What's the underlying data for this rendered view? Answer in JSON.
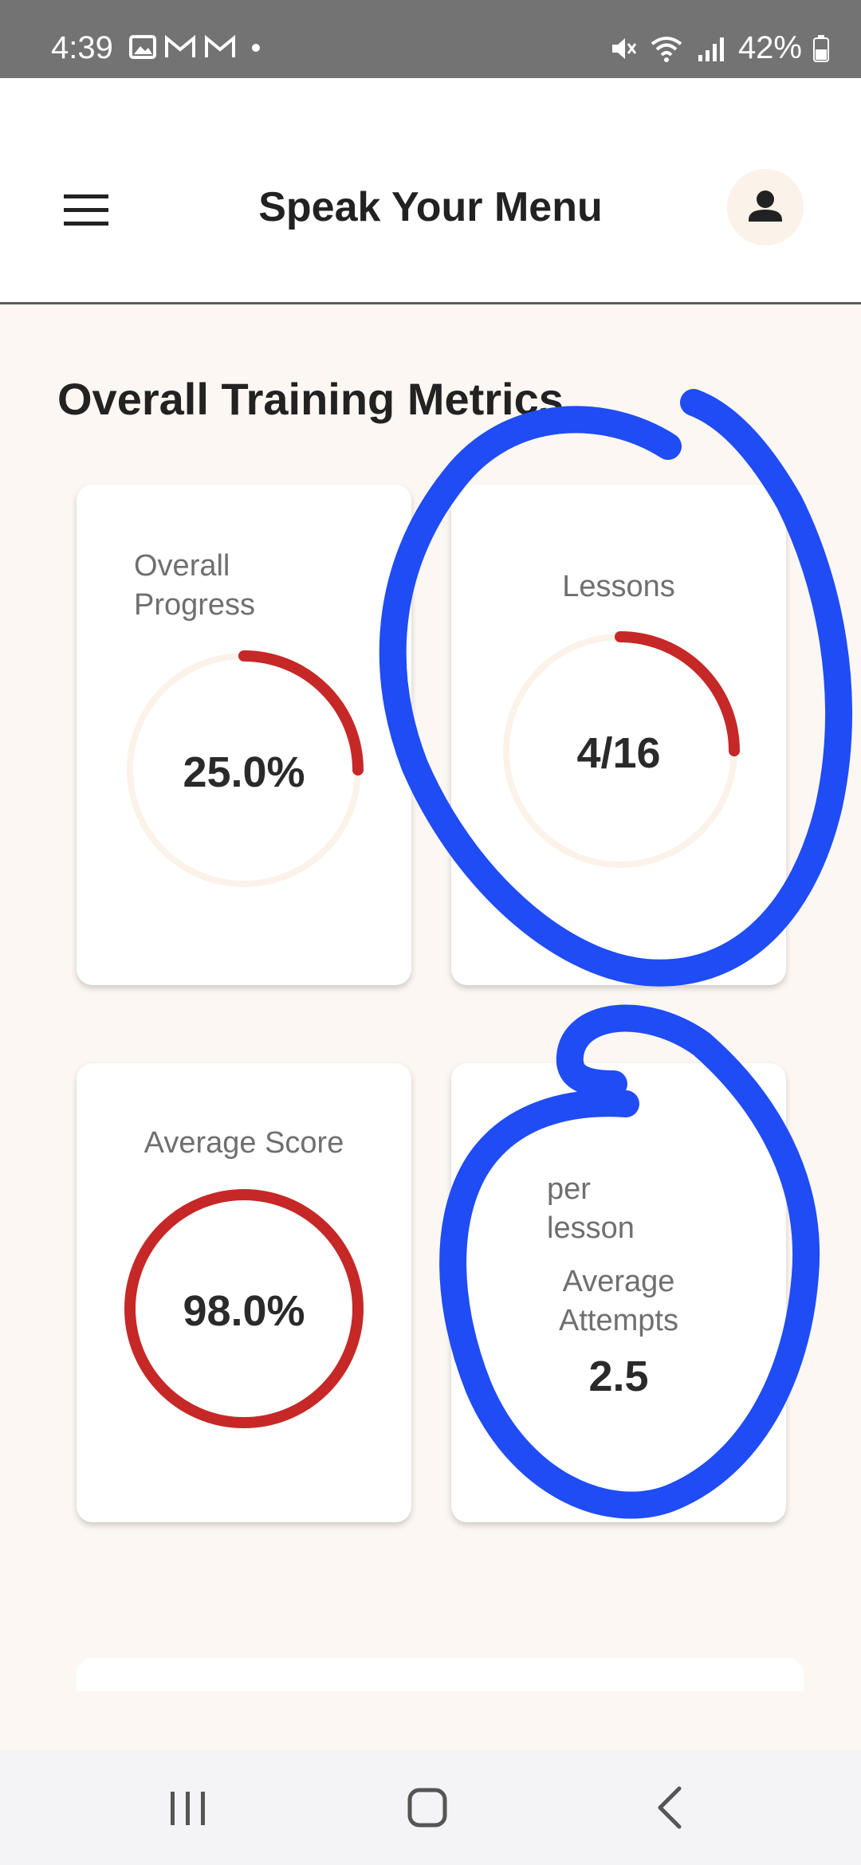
{
  "status_bar": {
    "time": "4:39",
    "battery": "42%",
    "icons": [
      "image-icon",
      "gmail-icon",
      "gmail-icon",
      "dot-icon",
      "mute-icon",
      "wifi-icon",
      "signal-icon",
      "battery-icon"
    ]
  },
  "app_bar": {
    "title": "Speak Your Menu",
    "menu_icon": "hamburger-menu-icon",
    "profile_icon": "person-icon"
  },
  "section": {
    "title": "Overall Training Metrics"
  },
  "metrics": {
    "overall_progress": {
      "label_line1": "Overall",
      "label_line2": "Progress",
      "value": "25.0%",
      "fraction": 0.25
    },
    "lessons": {
      "label": "Lessons",
      "value": "4/16",
      "fraction": 0.25
    },
    "average_score": {
      "label": "Average Score",
      "value": "98.0%",
      "fraction": 1.0
    },
    "average_attempts": {
      "sub_line1": "per",
      "sub_line2": "lesson",
      "label_line1": "Average",
      "label_line2": "Attempts",
      "value": "2.5"
    }
  },
  "colors": {
    "accent_red": "#c62828",
    "track": "#fbf2ea",
    "annotation_blue": "#1f4cf5",
    "background": "#fcf7f2"
  }
}
